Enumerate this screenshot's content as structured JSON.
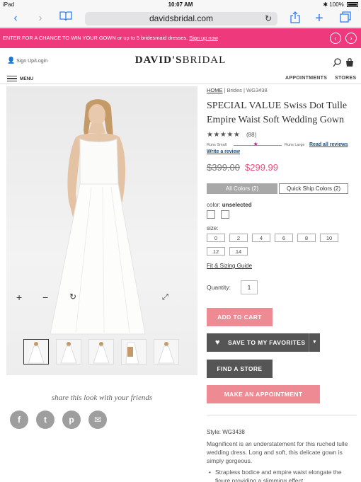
{
  "status_bar": {
    "device": "iPad",
    "time": "10:07 AM",
    "battery": "100%"
  },
  "browser": {
    "url": "davidsbridal.com"
  },
  "promo": {
    "text": "ENTER FOR A CHANCE TO WIN YOUR GOWN or up to 5 bridesmaid dresses.",
    "link": "Sign up now"
  },
  "header": {
    "sign_in": "Sign Up/Login",
    "logo_bold": "DAVID'S",
    "logo_light": "BRIDAL",
    "menu": "MENU",
    "nav": [
      "APPOINTMENTS",
      "STORES"
    ]
  },
  "share": {
    "label": "share this look with your friends",
    "networks": [
      "f",
      "t",
      "p",
      "✉"
    ]
  },
  "product": {
    "breadcrumb": [
      "HOME",
      "Brides",
      "WG3438"
    ],
    "title": "SPECIAL VALUE Swiss Dot Tulle Empire Waist Soft Wedding Gown",
    "rating": 5,
    "review_count": "(88)",
    "fit_small": "Runs Small",
    "fit_large": "Runs Large",
    "fit_position": 0.45,
    "read_all_reviews": "Read all reviews",
    "write_review": "Write a review",
    "price_original": "$399.00",
    "price_sale": "$299.99",
    "tabs": [
      "All Colors (2)",
      "Quick Ship Colors (2)"
    ],
    "color_label": "color:",
    "color_value": "unselected",
    "size_label": "size:",
    "sizes": [
      "0",
      "2",
      "4",
      "6",
      "8",
      "10",
      "12",
      "14"
    ],
    "fit_guide": "Fit & Sizing Guide",
    "quantity_label": "Quantity:",
    "quantity": "1",
    "add_to_cart": "ADD TO CART",
    "save_favorites": "SAVE TO MY FAVORITES",
    "find_store": "FIND A STORE",
    "make_appointment": "MAKE AN APPOINTMENT",
    "style": "Style: WG3438",
    "description": "Magnificent is an understatement for this ruched tulle wedding dress. Long and soft, this delicate gown is simply gorgeous.",
    "bullet": "Strapless bodice and empire waist elongate the figure providing a slimming effect"
  },
  "colors": {
    "brand_pink": "#ee3a7c",
    "button_pink": "#ee8a93",
    "button_dark": "#555555",
    "link_blue": "#1e4b78"
  }
}
